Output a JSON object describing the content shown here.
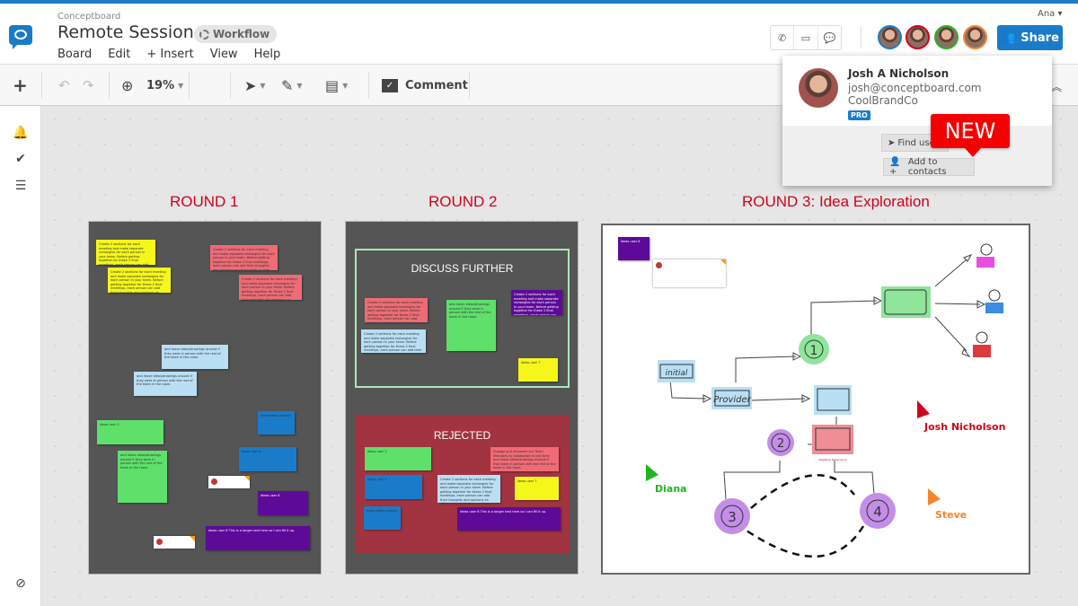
{
  "header": {
    "brand": "Conceptboard",
    "title": "Remote Session",
    "workflow_label": "Workflow",
    "menu": [
      "Board",
      "Edit",
      "+ Insert",
      "View",
      "Help"
    ],
    "current_user": "Ana ▾",
    "share_label": "Share",
    "call_icons": [
      "phone-icon",
      "presentation-icon",
      "chat-icon"
    ],
    "participants": [
      {
        "name": "user-1",
        "color": "#1a7bc9"
      },
      {
        "name": "Josh A Nicholson",
        "color": "#d0021b"
      },
      {
        "name": "Diana",
        "color": "#21b521"
      },
      {
        "name": "Steve",
        "color": "#f5862c"
      }
    ]
  },
  "toolbar": {
    "zoom_level": "19%",
    "comment_label": "Comment"
  },
  "popover": {
    "name": "Josh A Nicholson",
    "email": "josh@conceptboard.com",
    "company": "CoolBrandCo",
    "badge": "PRO",
    "find_user": "Find user",
    "add_contacts": "Add to contacts",
    "new_badge": "NEW"
  },
  "canvas": {
    "rounds": [
      {
        "title": "ROUND 1"
      },
      {
        "title": "ROUND 2",
        "sections": [
          "DISCUSS FURTHER",
          "REJECTED"
        ]
      },
      {
        "title": "ROUND 3: Idea Exploration"
      }
    ],
    "notes": {
      "create": "Create 2 sections for each meeting and make separate rectangles for each person in your team. Before getting together for these 2 final meetings, each person can add their thoughts and opinions on sticky notes in their respective rectangles.",
      "move": "and move ideas/drawings around if they were in person with the rest of the team in the room.",
      "ideas3": "Ideas user 3",
      "ideas4": "Ideas user 4",
      "ideas5": "Ideas user 5",
      "ideas6": "Ideas user 6 This is a longer text here so I can fill it up.",
      "ideas7": "Ideas user 7",
      "ideas8": "Ideas user 8",
      "move_ideas": "move ideas around",
      "engage": "Engage and empower our Team Members to collaborate in real time and move ideas/drawings around if they were in person with the rest of the team in the room."
    },
    "diagram": {
      "initial": "initial",
      "provider": "Provider",
      "nodes": [
        "1",
        "2",
        "3",
        "4"
      ],
      "neg_label": "Negative Experience"
    },
    "cursors": [
      {
        "name": "Josh Nicholson",
        "color": "#d0021b"
      },
      {
        "name": "Diana",
        "color": "#21b521"
      },
      {
        "name": "Steve",
        "color": "#f5862c"
      }
    ]
  }
}
